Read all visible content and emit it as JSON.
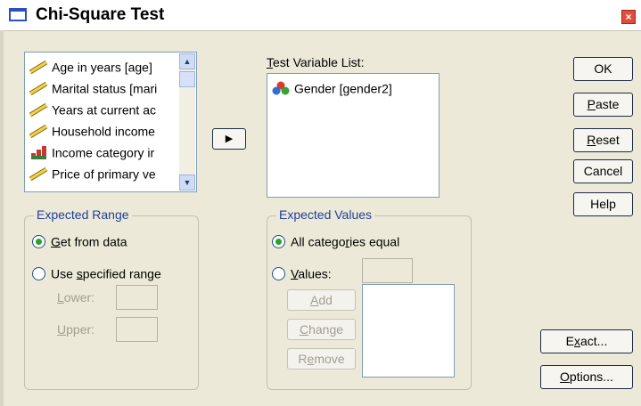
{
  "window": {
    "title": "Chi-Square Test",
    "close_glyph": "×"
  },
  "source_list": {
    "items": [
      {
        "label": "Age in years [age]",
        "icon": "ruler-scale-icon"
      },
      {
        "label": "Marital status [mari",
        "icon": "ruler-scale-icon"
      },
      {
        "label": "Years at current ac",
        "icon": "ruler-scale-icon"
      },
      {
        "label": "Household income",
        "icon": "ruler-scale-icon"
      },
      {
        "label": "Income category ir",
        "icon": "bar-ordinal-icon"
      },
      {
        "label": "Price of primary ve",
        "icon": "ruler-scale-icon"
      }
    ],
    "scroll_up": "▲",
    "scroll_down": "▼"
  },
  "move_button": {
    "glyph": "▶"
  },
  "test_variable_list": {
    "label_mnemonic": "T",
    "label_rest": "est Variable List:",
    "items": [
      {
        "label": "Gender [gender2]",
        "icon": "nominal-balls-icon"
      }
    ]
  },
  "buttons": {
    "ok": "OK",
    "paste_m": "P",
    "paste_rest": "aste",
    "reset_m": "R",
    "reset_rest": "eset",
    "cancel": "Cancel",
    "help": "Help",
    "exact_pre": "E",
    "exact_m": "x",
    "exact_rest": "act...",
    "options_m": "O",
    "options_rest": "ptions..."
  },
  "expected_range": {
    "title": "Expected Range",
    "get_from_data_m": "G",
    "get_from_data_rest": "et from data",
    "use_specified_pre": "Use ",
    "use_specified_m": "s",
    "use_specified_rest": "pecified range",
    "lower_m": "L",
    "lower_rest": "ower:",
    "upper_m": "U",
    "upper_rest": "pper:",
    "lower_value": "",
    "upper_value": "",
    "selected": "get_from_data"
  },
  "expected_values": {
    "title": "Expected Values",
    "all_equal_pre": "All catego",
    "all_equal_m": "r",
    "all_equal_rest": "ies equal",
    "values_m": "V",
    "values_rest": "alues:",
    "values_value": "",
    "add_m": "A",
    "add_rest": "dd",
    "change_m": "C",
    "change_rest": "hange",
    "remove_pre": "R",
    "remove_m": "e",
    "remove_rest": "move",
    "selected": "all_categories_equal"
  },
  "colors": {
    "accent": "#1f3f9a",
    "selected_radio": "#2aa22a",
    "disabled_text": "#a19f92"
  }
}
